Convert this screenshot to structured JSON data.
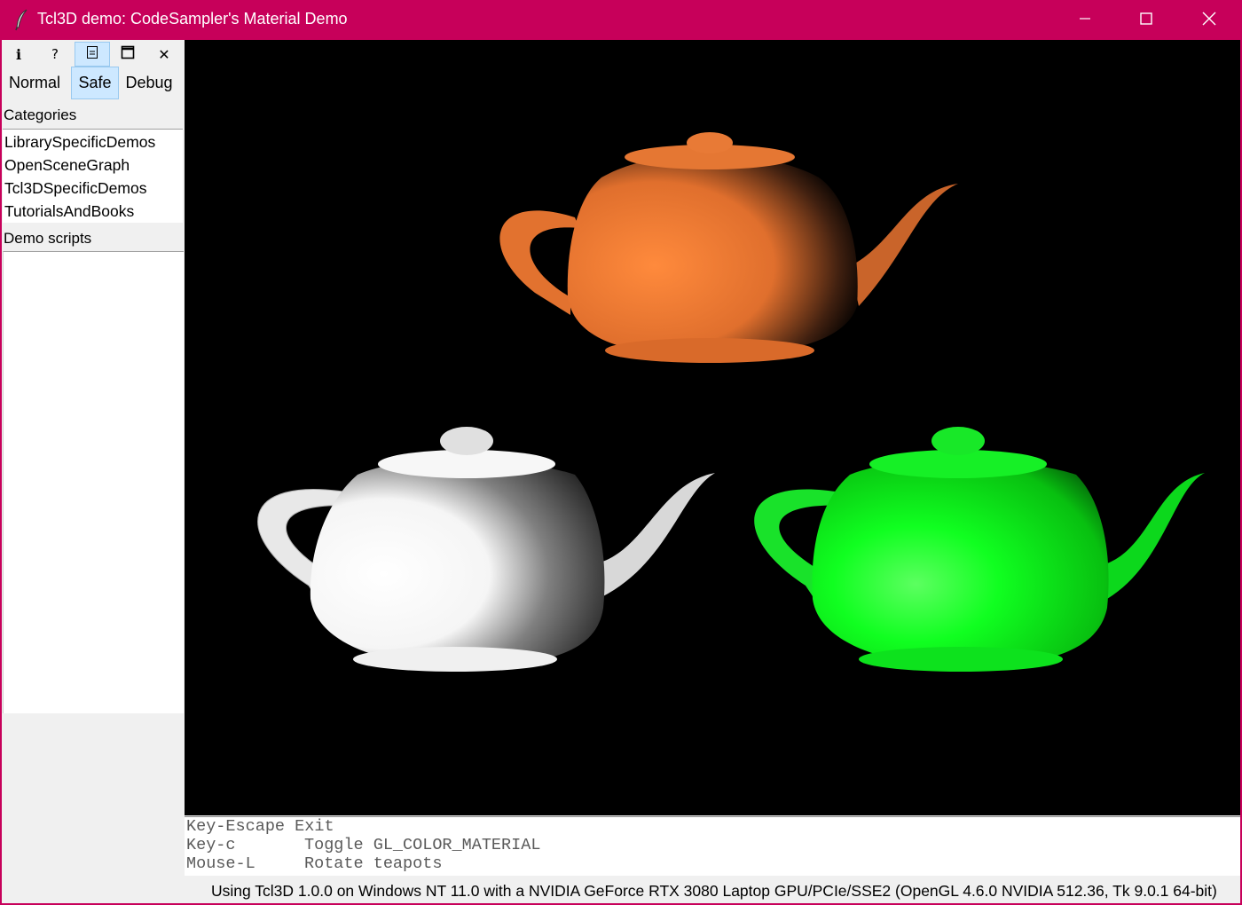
{
  "window": {
    "title": "Tcl3D demo: CodeSampler's Material Demo"
  },
  "toolbar": {
    "info_glyph": "i",
    "help_glyph": "?",
    "doc_icon": "document-icon",
    "window_icon": "window-icon",
    "close_glyph": "✕"
  },
  "modes": {
    "normal": "Normal",
    "safe": "Safe",
    "debug": "Debug",
    "active": "Safe"
  },
  "sidebar": {
    "categories_label": "Categories",
    "categories": [
      "LibrarySpecificDemos",
      "OpenSceneGraph",
      "Tcl3DSpecificDemos",
      "TutorialsAndBooks"
    ],
    "demo_scripts_label": "Demo scripts"
  },
  "scene": {
    "background": "#000000",
    "teapot_colors": [
      "#ff7f35",
      "#ffffff",
      "#00ff11"
    ]
  },
  "info": {
    "lines": [
      {
        "key": "Key-Escape",
        "action": "Exit"
      },
      {
        "key": "Key-c",
        "action": "Toggle GL_COLOR_MATERIAL"
      },
      {
        "key": "Mouse-L",
        "action": "Rotate teapots"
      }
    ]
  },
  "status": {
    "text": "Using Tcl3D 1.0.0 on Windows NT 11.0 with a NVIDIA GeForce RTX 3080 Laptop GPU/PCIe/SSE2 (OpenGL 4.6.0 NVIDIA 512.36, Tk 9.0.1 64-bit)"
  },
  "colors": {
    "titlebar": "#c7005a",
    "selected_button": "#cde8ff"
  }
}
